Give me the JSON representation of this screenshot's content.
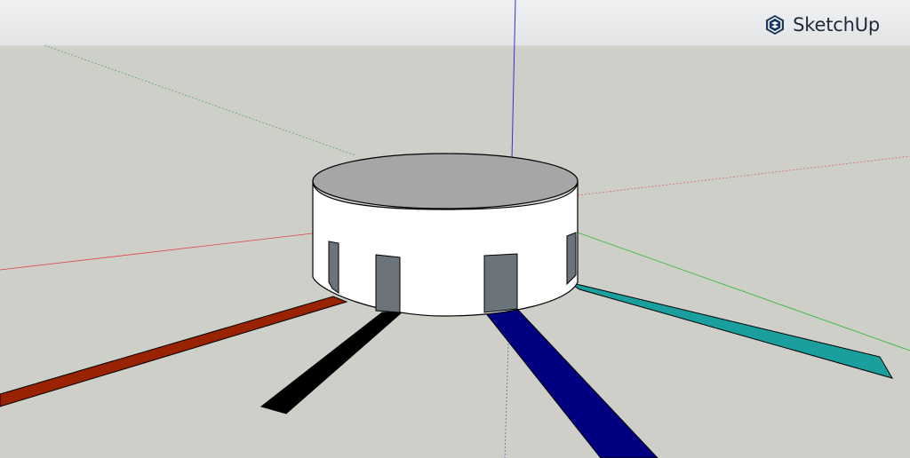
{
  "app": {
    "brand_name": "SketchUp",
    "logo_icon": "sketchup-logo-icon"
  },
  "colors": {
    "sky": "#eceded",
    "ground": "#cfcfca",
    "axis_red": "#d23a3a",
    "axis_green": "#3aa63a",
    "axis_blue": "#3a3ad2",
    "cylinder_side": "#ffffff",
    "cylinder_top": "#a6a6a6",
    "door": "#6c747b",
    "path_brown": "#992200",
    "path_black": "#000000",
    "path_navy": "#000080",
    "path_teal": "#1a9e9e"
  },
  "scene": {
    "object": "cylinder-with-doors",
    "door_count": 4,
    "path_count": 4
  }
}
